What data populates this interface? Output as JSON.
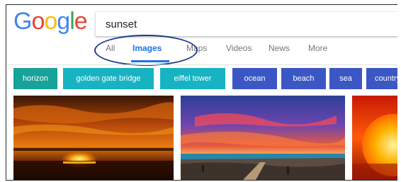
{
  "logo": {
    "letters": [
      "G",
      "o",
      "o",
      "g",
      "l",
      "e"
    ],
    "colors": [
      "#4285F4",
      "#EA4335",
      "#FBBC05",
      "#4285F4",
      "#34A853",
      "#EA4335"
    ]
  },
  "search": {
    "value": "sunset"
  },
  "tabs": [
    {
      "label": "All",
      "active": false
    },
    {
      "label": "Images",
      "active": true
    },
    {
      "label": "Maps",
      "active": false
    },
    {
      "label": "Videos",
      "active": false
    },
    {
      "label": "News",
      "active": false
    },
    {
      "label": "More",
      "active": false
    }
  ],
  "chips": [
    {
      "label": "horizon",
      "color": "#17a29a"
    },
    {
      "label": "golden gate bridge",
      "color": "#17b3c2"
    },
    {
      "label": "eiffel tower",
      "color": "#17b3c2"
    },
    {
      "label": "ocean",
      "color": "#3b57c4"
    },
    {
      "label": "beach",
      "color": "#3b57c4"
    },
    {
      "label": "sea",
      "color": "#3b57c4"
    },
    {
      "label": "country",
      "color": "#3b57c4"
    }
  ],
  "images": [
    {
      "name": "sunset-horizon-photo"
    },
    {
      "name": "sunset-beach-path-photo"
    },
    {
      "name": "sunset-sun-photo"
    }
  ]
}
